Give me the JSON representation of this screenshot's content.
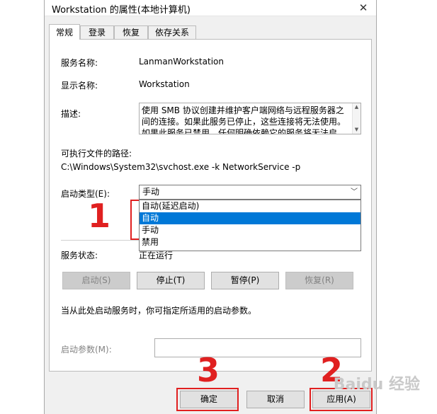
{
  "window": {
    "title": "Workstation 的属性(本地计算机)",
    "close_glyph": "✕"
  },
  "tabs": [
    {
      "label": "常规",
      "active": true
    },
    {
      "label": "登录",
      "active": false
    },
    {
      "label": "恢复",
      "active": false
    },
    {
      "label": "依存关系",
      "active": false
    }
  ],
  "general": {
    "service_name_label": "服务名称:",
    "service_name": "LanmanWorkstation",
    "display_name_label": "显示名称:",
    "display_name": "Workstation",
    "description_label": "描述:",
    "description": "使用 SMB 协议创建并维护客户端网络与远程服务器之间的连接。如果此服务已停止，这些连接将无法使用。如果此服务已禁用，任何明确依赖它的服务将无法启动。",
    "path_label": "可执行文件的路径:",
    "path": "C:\\Windows\\System32\\svchost.exe -k NetworkService -p",
    "startup_type_label": "启动类型(E):",
    "startup_type_value": "手动",
    "startup_options": [
      "自动(延迟启动)",
      "自动",
      "手动",
      "禁用"
    ],
    "startup_selected_index": 1,
    "status_label": "服务状态:",
    "status_value": "正在运行",
    "buttons": {
      "start": "启动(S)",
      "stop": "停止(T)",
      "pause": "暂停(P)",
      "resume": "恢复(R)"
    },
    "hint": "当从此处启动服务时，你可指定所适用的启动参数。",
    "params_label": "启动参数(M):",
    "params_value": ""
  },
  "footer": {
    "ok": "确定",
    "cancel": "取消",
    "apply": "应用(A)"
  },
  "annotations": {
    "dropdown_number": "1",
    "apply_number": "2",
    "ok_number": "3",
    "color": "#e02020"
  },
  "watermark": "Baidu 经验"
}
